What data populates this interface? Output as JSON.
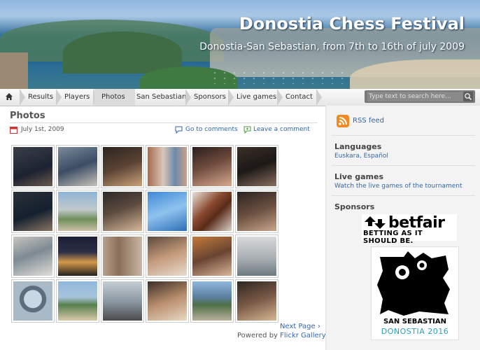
{
  "header": {
    "title": "Donostia Chess Festival",
    "subtitle": "Donostia-San Sebastian, from 7th to 16th of july 2009"
  },
  "nav": {
    "items": [
      "Results",
      "Players",
      "Photos",
      "San Sebastian",
      "Sponsors",
      "Live games",
      "Contact"
    ],
    "active": "Photos",
    "search_placeholder": "Type text to search here..."
  },
  "post": {
    "title": "Photos",
    "date": "July 1st, 2009",
    "goto_comments": "Go to comments",
    "leave_comment": "Leave a comment"
  },
  "gallery": {
    "next_page": "Next Page ›",
    "powered_prefix": "Powered by",
    "powered_link": "Flickr Gallery"
  },
  "sidebar": {
    "rss_label": "RSS feed",
    "languages_title": "Languages",
    "languages_links": "Euskara, Español",
    "live_title": "Live games",
    "live_link": "Watch the live games of the tournament",
    "sponsors_title": "Sponsors",
    "betfair_logo": "betfair",
    "betfair_tagline": "BETTING AS IT SHOULD BE.",
    "ss_line1": "SAN SEBASTIAN",
    "ss_line2": "DONOSTIA 2016"
  },
  "colors": {
    "link": "#3366aa",
    "rss": "#f08a24",
    "ss_accent": "#2a9fc0"
  }
}
